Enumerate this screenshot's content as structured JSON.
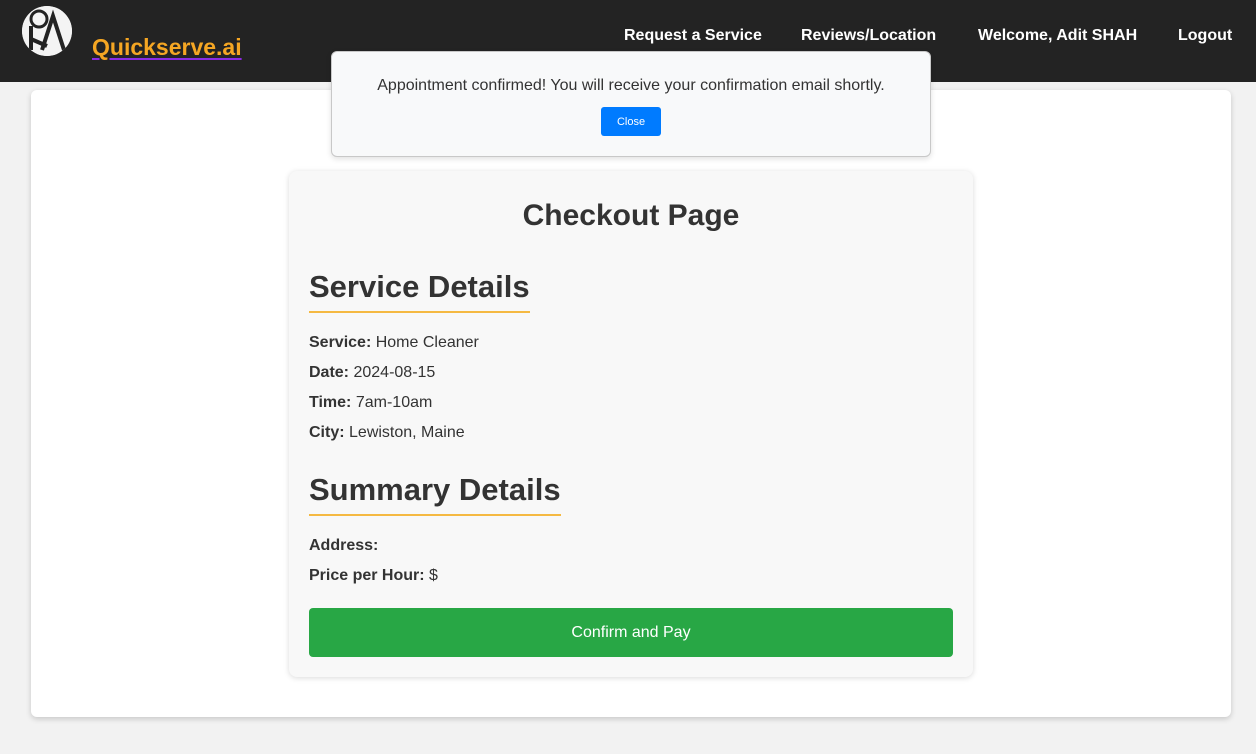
{
  "navbar": {
    "brand": "Quickserve.ai",
    "logo_icon": "quickserve-logo-icon",
    "links": {
      "request": "Request a Service",
      "reviews": "Reviews/Location",
      "welcome": "Welcome, Adit SHAH",
      "logout": "Logout"
    }
  },
  "modal": {
    "message": "Appointment confirmed! You will receive your confirmation email shortly.",
    "close_label": "Close"
  },
  "checkout": {
    "title": "Checkout Page",
    "service_details": {
      "heading": "Service Details",
      "service_label": "Service:",
      "service_value": "Home Cleaner",
      "date_label": "Date:",
      "date_value": "2024-08-15",
      "time_label": "Time:",
      "time_value": "7am-10am",
      "city_label": "City:",
      "city_value": "Lewiston, Maine"
    },
    "summary_details": {
      "heading": "Summary Details",
      "address_label": "Address:",
      "address_value": "",
      "price_label": "Price per Hour:",
      "price_value": "$"
    },
    "pay_button": "Confirm and Pay"
  },
  "colors": {
    "navbar_bg": "#232323",
    "brand": "#f5a623",
    "heading_underline": "#f5b942",
    "pay_button": "#28a745",
    "close_button": "#007bff"
  }
}
